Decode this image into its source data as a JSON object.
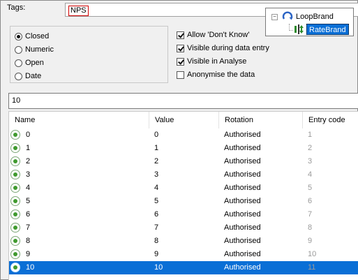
{
  "tags": {
    "label": "Tags:",
    "chip": "NPS"
  },
  "tree": {
    "parent_label": "LoopBrand",
    "child_label": "RateBrand",
    "collapse_glyph": "−"
  },
  "response_type": {
    "options": [
      {
        "label": "Closed",
        "checked": true
      },
      {
        "label": "Numeric",
        "checked": false
      },
      {
        "label": "Open",
        "checked": false
      },
      {
        "label": "Date",
        "checked": false
      }
    ]
  },
  "flags": [
    {
      "label": "Allow 'Don't Know'",
      "checked": true
    },
    {
      "label": "Visible during data entry",
      "checked": true
    },
    {
      "label": "Visible in Analyse",
      "checked": true
    },
    {
      "label": "Anonymise the data",
      "checked": false
    }
  ],
  "value_input": "10",
  "grid": {
    "columns": [
      "Name",
      "Value",
      "Rotation",
      "Entry code"
    ],
    "rows": [
      {
        "name": "0",
        "value": "0",
        "rotation": "Authorised",
        "entry": "1"
      },
      {
        "name": "1",
        "value": "1",
        "rotation": "Authorised",
        "entry": "2"
      },
      {
        "name": "2",
        "value": "2",
        "rotation": "Authorised",
        "entry": "3"
      },
      {
        "name": "3",
        "value": "3",
        "rotation": "Authorised",
        "entry": "4"
      },
      {
        "name": "4",
        "value": "4",
        "rotation": "Authorised",
        "entry": "5"
      },
      {
        "name": "5",
        "value": "5",
        "rotation": "Authorised",
        "entry": "6"
      },
      {
        "name": "6",
        "value": "6",
        "rotation": "Authorised",
        "entry": "7"
      },
      {
        "name": "7",
        "value": "7",
        "rotation": "Authorised",
        "entry": "8"
      },
      {
        "name": "8",
        "value": "8",
        "rotation": "Authorised",
        "entry": "9"
      },
      {
        "name": "9",
        "value": "9",
        "rotation": "Authorised",
        "entry": "10"
      },
      {
        "name": "10",
        "value": "10",
        "rotation": "Authorised",
        "entry": "11"
      }
    ],
    "selected_index": 10
  },
  "colors": {
    "selection": "#0a6fd6",
    "tag_border": "#d00000",
    "row_icon": "#3f9a2e"
  },
  "icons": {
    "row": "green-radio-dot-icon",
    "loop": "loop-arrow-icon",
    "rate": "rate-scale-icon"
  }
}
